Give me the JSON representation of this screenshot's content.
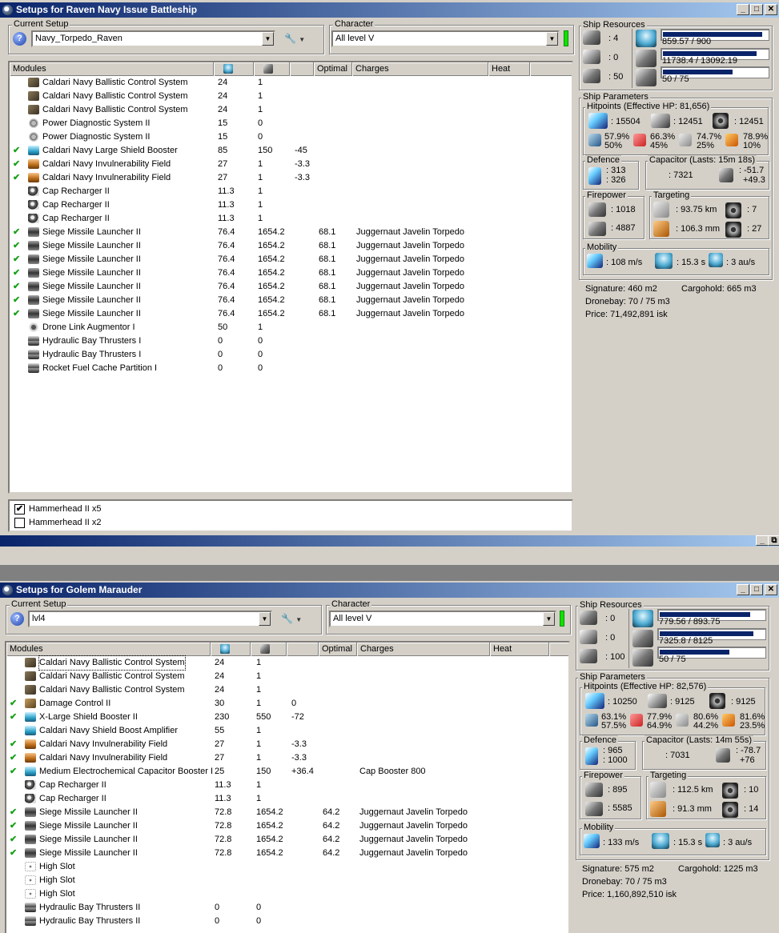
{
  "w1": {
    "title": "Setups for Raven Navy Issue Battleship",
    "current_setup_label": "Current Setup",
    "setup_value": "Navy_Torpedo_Raven",
    "character_label": "Character",
    "character_value": "All level V",
    "columns": {
      "modules": "Modules",
      "optimal": "Optimal",
      "charges": "Charges",
      "heat": "Heat"
    },
    "modules": [
      {
        "chk": "",
        "icon": "bcs",
        "name": "Caldari Navy Ballistic Control System",
        "cpu": "24",
        "pg": "1",
        "cap": "",
        "optimal": "",
        "charge": ""
      },
      {
        "chk": "",
        "icon": "bcs",
        "name": "Caldari Navy Ballistic Control System",
        "cpu": "24",
        "pg": "1",
        "cap": "",
        "optimal": "",
        "charge": ""
      },
      {
        "chk": "",
        "icon": "bcs",
        "name": "Caldari Navy Ballistic Control System",
        "cpu": "24",
        "pg": "1",
        "cap": "",
        "optimal": "",
        "charge": ""
      },
      {
        "chk": "",
        "icon": "pds",
        "name": "Power Diagnostic System II",
        "cpu": "15",
        "pg": "0",
        "cap": "",
        "optimal": "",
        "charge": ""
      },
      {
        "chk": "",
        "icon": "pds",
        "name": "Power Diagnostic System II",
        "cpu": "15",
        "pg": "0",
        "cap": "",
        "optimal": "",
        "charge": ""
      },
      {
        "chk": "✔",
        "icon": "sb",
        "name": "Caldari Navy Large Shield Booster",
        "cpu": "85",
        "pg": "150",
        "cap": "-45",
        "optimal": "",
        "charge": ""
      },
      {
        "chk": "✔",
        "icon": "inv",
        "name": "Caldari Navy Invulnerability Field",
        "cpu": "27",
        "pg": "1",
        "cap": "-3.3",
        "optimal": "",
        "charge": ""
      },
      {
        "chk": "✔",
        "icon": "inv",
        "name": "Caldari Navy Invulnerability Field",
        "cpu": "27",
        "pg": "1",
        "cap": "-3.3",
        "optimal": "",
        "charge": ""
      },
      {
        "chk": "",
        "icon": "cap",
        "name": "Cap Recharger II",
        "cpu": "11.3",
        "pg": "1",
        "cap": "",
        "optimal": "",
        "charge": ""
      },
      {
        "chk": "",
        "icon": "cap",
        "name": "Cap Recharger II",
        "cpu": "11.3",
        "pg": "1",
        "cap": "",
        "optimal": "",
        "charge": ""
      },
      {
        "chk": "",
        "icon": "cap",
        "name": "Cap Recharger II",
        "cpu": "11.3",
        "pg": "1",
        "cap": "",
        "optimal": "",
        "charge": ""
      },
      {
        "chk": "✔",
        "icon": "sml",
        "name": "Siege Missile Launcher II",
        "cpu": "76.4",
        "pg": "1654.2",
        "cap": "",
        "optimal": "68.1",
        "charge": "Juggernaut Javelin Torpedo"
      },
      {
        "chk": "✔",
        "icon": "sml",
        "name": "Siege Missile Launcher II",
        "cpu": "76.4",
        "pg": "1654.2",
        "cap": "",
        "optimal": "68.1",
        "charge": "Juggernaut Javelin Torpedo"
      },
      {
        "chk": "✔",
        "icon": "sml",
        "name": "Siege Missile Launcher II",
        "cpu": "76.4",
        "pg": "1654.2",
        "cap": "",
        "optimal": "68.1",
        "charge": "Juggernaut Javelin Torpedo"
      },
      {
        "chk": "✔",
        "icon": "sml",
        "name": "Siege Missile Launcher II",
        "cpu": "76.4",
        "pg": "1654.2",
        "cap": "",
        "optimal": "68.1",
        "charge": "Juggernaut Javelin Torpedo"
      },
      {
        "chk": "✔",
        "icon": "sml",
        "name": "Siege Missile Launcher II",
        "cpu": "76.4",
        "pg": "1654.2",
        "cap": "",
        "optimal": "68.1",
        "charge": "Juggernaut Javelin Torpedo"
      },
      {
        "chk": "✔",
        "icon": "sml",
        "name": "Siege Missile Launcher II",
        "cpu": "76.4",
        "pg": "1654.2",
        "cap": "",
        "optimal": "68.1",
        "charge": "Juggernaut Javelin Torpedo"
      },
      {
        "chk": "✔",
        "icon": "sml",
        "name": "Siege Missile Launcher II",
        "cpu": "76.4",
        "pg": "1654.2",
        "cap": "",
        "optimal": "68.1",
        "charge": "Juggernaut Javelin Torpedo"
      },
      {
        "chk": "",
        "icon": "dla",
        "name": "Drone Link Augmentor I",
        "cpu": "50",
        "pg": "1",
        "cap": "",
        "optimal": "",
        "charge": ""
      },
      {
        "chk": "",
        "icon": "hbt",
        "name": "Hydraulic Bay Thrusters I",
        "cpu": "0",
        "pg": "0",
        "cap": "",
        "optimal": "",
        "charge": ""
      },
      {
        "chk": "",
        "icon": "hbt",
        "name": "Hydraulic Bay Thrusters I",
        "cpu": "0",
        "pg": "0",
        "cap": "",
        "optimal": "",
        "charge": ""
      },
      {
        "chk": "",
        "icon": "hbt",
        "name": "Rocket Fuel Cache Partition I",
        "cpu": "0",
        "pg": "0",
        "cap": "",
        "optimal": "",
        "charge": ""
      }
    ],
    "drones": [
      {
        "checked": "✔",
        "label": "Hammerhead II x5"
      },
      {
        "checked": "",
        "label": "Hammerhead II x2"
      }
    ],
    "resources": {
      "label": "Ship Resources",
      "turret": ": 4",
      "launcher": ": 0",
      "calib": ": 50",
      "cpu": "859.57 / 900",
      "cpu_frac": 0.955,
      "pg": "11738.4 / 13092.19",
      "pg_frac": 0.897,
      "drone": "50 / 75",
      "drone_frac": 0.667
    },
    "params": {
      "label": "Ship Parameters",
      "hp_label": "Hitpoints (Effective HP: 81,656)",
      "shield": ": 15504",
      "armor": ": 12451",
      "structure": ": 12451",
      "em": [
        "57.9%",
        "50%"
      ],
      "th": [
        "66.3%",
        "45%"
      ],
      "kin": [
        "74.7%",
        "25%"
      ],
      "exp": [
        "78.9%",
        "10%"
      ],
      "def_label": "Defence",
      "def1": ": 313",
      "def2": ": 326",
      "cap_label": "Capacitor (Lasts: 15m 18s)",
      "cap_val": ": 7321",
      "cap_d1": ": -51.7",
      "cap_d2": "+49.3",
      "fire_label": "Firepower",
      "fire1": ": 1018",
      "fire2": ": 4887",
      "targ_label": "Targeting",
      "range": ": 93.75 km",
      "maxt": ": 7",
      "scan": ": 106.3 mm",
      "sens": ": 27",
      "mob_label": "Mobility",
      "speed": ": 108 m/s",
      "align": ": 15.3 s",
      "warp": ": 3 au/s",
      "signature": "Signature: 460 m2",
      "cargo": "Cargohold: 665 m3",
      "dronebay": "Dronebay: 70 / 75 m3",
      "price": "Price: 71,492,891 isk"
    }
  },
  "w2": {
    "title": "Setups for Golem Marauder",
    "current_setup_label": "Current Setup",
    "setup_value": "lvl4",
    "character_label": "Character",
    "character_value": "All level V",
    "columns": {
      "modules": "Modules",
      "optimal": "Optimal",
      "charges": "Charges",
      "heat": "Heat"
    },
    "modules": [
      {
        "chk": "",
        "icon": "bcs",
        "name": "Caldari Navy Ballistic Control System",
        "cpu": "24",
        "pg": "1",
        "cap": "",
        "optimal": "",
        "charge": "",
        "sel": true
      },
      {
        "chk": "",
        "icon": "bcs",
        "name": "Caldari Navy Ballistic Control System",
        "cpu": "24",
        "pg": "1",
        "cap": "",
        "optimal": "",
        "charge": ""
      },
      {
        "chk": "",
        "icon": "bcs",
        "name": "Caldari Navy Ballistic Control System",
        "cpu": "24",
        "pg": "1",
        "cap": "",
        "optimal": "",
        "charge": ""
      },
      {
        "chk": "✔",
        "icon": "dc",
        "name": "Damage Control II",
        "cpu": "30",
        "pg": "1",
        "cap": "0",
        "optimal": "",
        "charge": ""
      },
      {
        "chk": "✔",
        "icon": "sb",
        "name": "X-Large Shield Booster II",
        "cpu": "230",
        "pg": "550",
        "cap": "-72",
        "optimal": "",
        "charge": ""
      },
      {
        "chk": "",
        "icon": "sb",
        "name": "Caldari Navy Shield Boost Amplifier",
        "cpu": "55",
        "pg": "1",
        "cap": "",
        "optimal": "",
        "charge": ""
      },
      {
        "chk": "✔",
        "icon": "inv",
        "name": "Caldari Navy Invulnerability Field",
        "cpu": "27",
        "pg": "1",
        "cap": "-3.3",
        "optimal": "",
        "charge": ""
      },
      {
        "chk": "✔",
        "icon": "inv",
        "name": "Caldari Navy Invulnerability Field",
        "cpu": "27",
        "pg": "1",
        "cap": "-3.3",
        "optimal": "",
        "charge": ""
      },
      {
        "chk": "✔",
        "icon": "sb",
        "name": "Medium Electrochemical Capacitor Booster I",
        "cpu": "25",
        "pg": "150",
        "cap": "+36.4",
        "optimal": "",
        "charge": "Cap Booster 800"
      },
      {
        "chk": "",
        "icon": "cap",
        "name": "Cap Recharger II",
        "cpu": "11.3",
        "pg": "1",
        "cap": "",
        "optimal": "",
        "charge": ""
      },
      {
        "chk": "",
        "icon": "cap",
        "name": "Cap Recharger II",
        "cpu": "11.3",
        "pg": "1",
        "cap": "",
        "optimal": "",
        "charge": ""
      },
      {
        "chk": "✔",
        "icon": "sml",
        "name": "Siege Missile Launcher II",
        "cpu": "72.8",
        "pg": "1654.2",
        "cap": "",
        "optimal": "64.2",
        "charge": "Juggernaut Javelin Torpedo"
      },
      {
        "chk": "✔",
        "icon": "sml",
        "name": "Siege Missile Launcher II",
        "cpu": "72.8",
        "pg": "1654.2",
        "cap": "",
        "optimal": "64.2",
        "charge": "Juggernaut Javelin Torpedo"
      },
      {
        "chk": "✔",
        "icon": "sml",
        "name": "Siege Missile Launcher II",
        "cpu": "72.8",
        "pg": "1654.2",
        "cap": "",
        "optimal": "64.2",
        "charge": "Juggernaut Javelin Torpedo"
      },
      {
        "chk": "✔",
        "icon": "sml",
        "name": "Siege Missile Launcher II",
        "cpu": "72.8",
        "pg": "1654.2",
        "cap": "",
        "optimal": "64.2",
        "charge": "Juggernaut Javelin Torpedo"
      },
      {
        "chk": "",
        "icon": "slot",
        "name": "High Slot",
        "cpu": "",
        "pg": "",
        "cap": "",
        "optimal": "",
        "charge": ""
      },
      {
        "chk": "",
        "icon": "slot",
        "name": "High Slot",
        "cpu": "",
        "pg": "",
        "cap": "",
        "optimal": "",
        "charge": ""
      },
      {
        "chk": "",
        "icon": "slot",
        "name": "High Slot",
        "cpu": "",
        "pg": "",
        "cap": "",
        "optimal": "",
        "charge": ""
      },
      {
        "chk": "",
        "icon": "hbt",
        "name": "Hydraulic Bay Thrusters II",
        "cpu": "0",
        "pg": "0",
        "cap": "",
        "optimal": "",
        "charge": ""
      },
      {
        "chk": "",
        "icon": "hbt",
        "name": "Hydraulic Bay Thrusters II",
        "cpu": "0",
        "pg": "0",
        "cap": "",
        "optimal": "",
        "charge": ""
      }
    ],
    "resources": {
      "label": "Ship Resources",
      "turret": ": 0",
      "launcher": ": 0",
      "calib": ": 100",
      "cpu": "779.56 / 893.75",
      "cpu_frac": 0.872,
      "pg": "7325.8 / 8125",
      "pg_frac": 0.902,
      "drone": "50 / 75",
      "drone_frac": 0.667
    },
    "params": {
      "label": "Ship Parameters",
      "hp_label": "Hitpoints (Effective HP: 82,576)",
      "shield": ": 10250",
      "armor": ": 9125",
      "structure": ": 9125",
      "em": [
        "63.1%",
        "57.5%"
      ],
      "th": [
        "77.9%",
        "64.9%"
      ],
      "kin": [
        "80.6%",
        "44.2%"
      ],
      "exp": [
        "81.6%",
        "23.5%"
      ],
      "def_label": "Defence",
      "def1": ": 965",
      "def2": ": 1000",
      "cap_label": "Capacitor (Lasts: 14m 55s)",
      "cap_val": ": 7031",
      "cap_d1": ": -78.7",
      "cap_d2": "+76",
      "fire_label": "Firepower",
      "fire1": ": 895",
      "fire2": ": 5585",
      "targ_label": "Targeting",
      "range": ": 112.5 km",
      "maxt": ": 10",
      "scan": ": 91.3 mm",
      "sens": ": 14",
      "mob_label": "Mobility",
      "speed": ": 133 m/s",
      "align": ": 15.3 s",
      "warp": ": 3 au/s",
      "signature": "Signature: 575 m2",
      "cargo": "Cargohold: 1225 m3",
      "dronebay": "Dronebay: 70 / 75 m3",
      "price": "Price: 1,160,892,510 isk"
    }
  },
  "icons": {
    "minimize": "_",
    "maximize": "□",
    "close": "✕",
    "restore": "⧉",
    "help": "?",
    "dropdown": "▼"
  }
}
